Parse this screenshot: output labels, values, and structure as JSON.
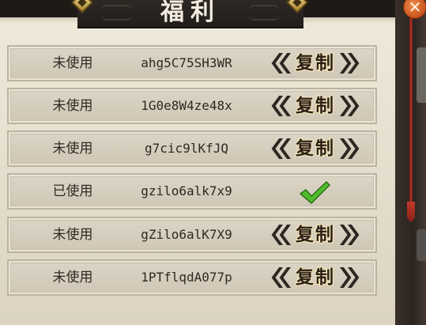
{
  "header": {
    "title": "福利"
  },
  "close_button": {
    "icon": "close-icon",
    "glyph": "✕"
  },
  "codes": [
    {
      "status": "未使用",
      "code": "ahg5C75SH3WR",
      "used": false,
      "action_label": "复制"
    },
    {
      "status": "未使用",
      "code": "1G0e8W4ze48x",
      "used": false,
      "action_label": "复制"
    },
    {
      "status": "未使用",
      "code": "g7cic9lKfJQ",
      "used": false,
      "action_label": "复制"
    },
    {
      "status": "已使用",
      "code": "gzilo6alk7x9",
      "used": true,
      "action_label": ""
    },
    {
      "status": "未使用",
      "code": "gZilo6alK7X9",
      "used": false,
      "action_label": "复制"
    },
    {
      "status": "未使用",
      "code": "1PTflqdA077p",
      "used": false,
      "action_label": "复制"
    }
  ],
  "colors": {
    "check_green": "#4ebc2c",
    "accent_red": "#b8362a"
  }
}
